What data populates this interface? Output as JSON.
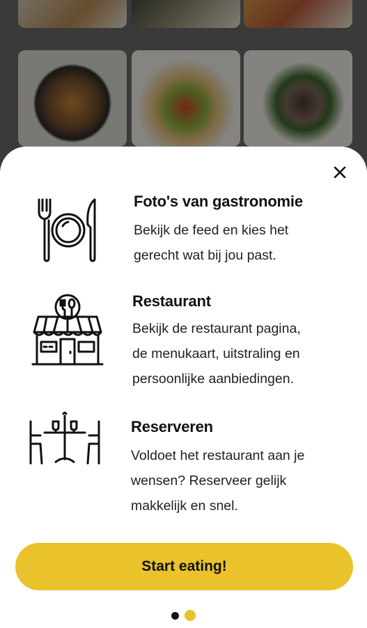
{
  "background": {
    "photos": [
      "food-photo-1",
      "food-photo-2",
      "food-photo-3",
      "food-photo-4",
      "food-photo-5",
      "food-photo-6"
    ]
  },
  "sheet": {
    "close_icon": "close-icon",
    "features": [
      {
        "icon": "cutlery-plate-icon",
        "title": "Foto's van gastronomie",
        "lines": [
          "Bekijk de feed en kies het",
          "gerecht wat bij jou past."
        ]
      },
      {
        "icon": "restaurant-storefront-icon",
        "title": "Restaurant",
        "lines": [
          "Bekijk de restaurant pagina,",
          "de menukaart, uitstraling en",
          "persoonlijke aanbiedingen."
        ]
      },
      {
        "icon": "dining-table-icon",
        "title": "Reserveren",
        "lines": [
          "Voldoet het restaurant aan je",
          "wensen? Reserveer gelijk",
          "makkelijk en snel."
        ]
      }
    ],
    "cta_label": "Start eating!",
    "pagination": {
      "total": 2,
      "active": 2
    }
  },
  "colors": {
    "accent": "#e9c22c",
    "text": "#111111"
  }
}
